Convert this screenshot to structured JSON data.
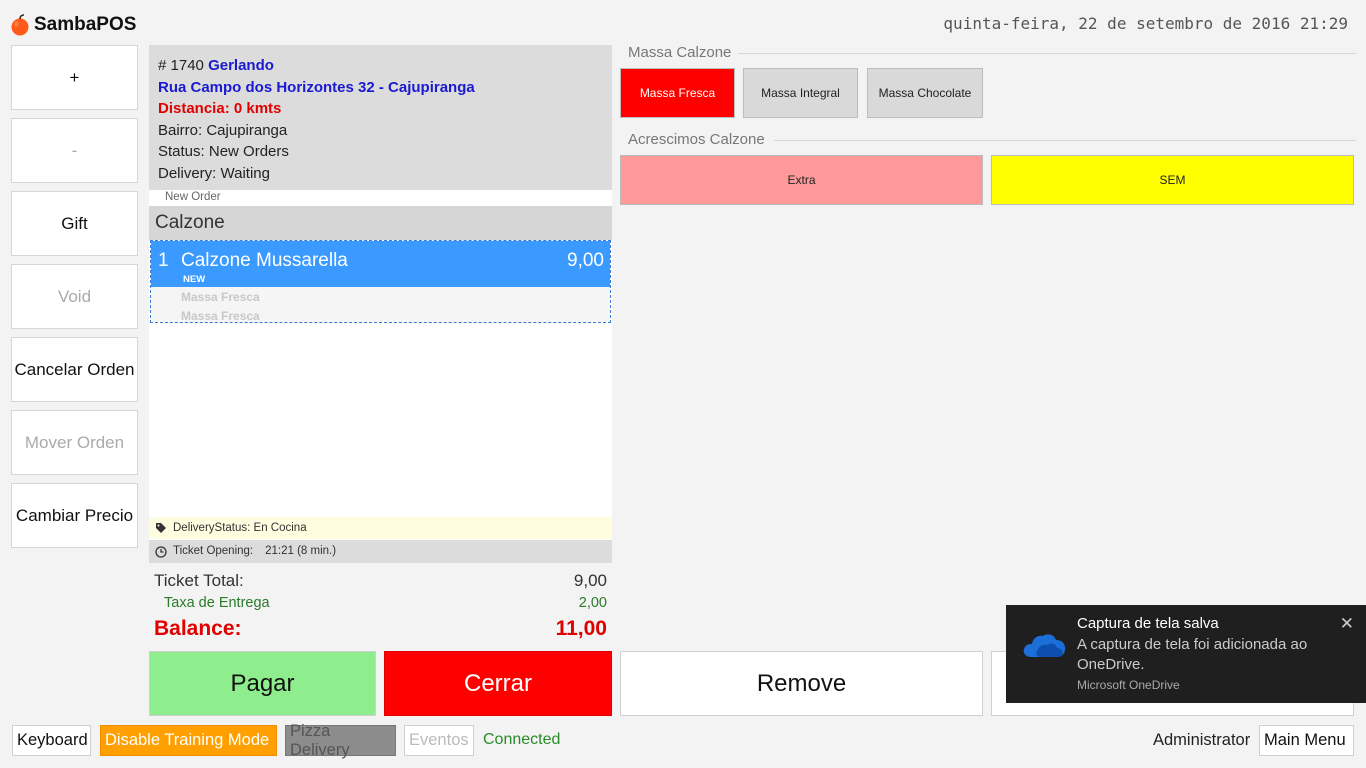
{
  "header": {
    "app_name": "SambaPOS",
    "datetime": "quinta-feira, 22 de setembro de 2016 21:29"
  },
  "commands": [
    {
      "label": "+",
      "enabled": true
    },
    {
      "label": "-",
      "enabled": false
    },
    {
      "label": "Gift",
      "enabled": true
    },
    {
      "label": "Void",
      "enabled": false
    },
    {
      "label": "Cancelar Orden",
      "enabled": true
    },
    {
      "label": "Mover Orden",
      "enabled": false
    },
    {
      "label": "Cambiar Precio",
      "enabled": true
    }
  ],
  "ticket": {
    "number": "# 1740",
    "customer": "Gerlando",
    "address": "Rua Campo dos Horizontes 32 - Cajupiranga",
    "distance": "Distancia: 0 kmts",
    "bairro": "Bairro: Cajupiranga",
    "status": "Status: New Orders",
    "delivery": "Delivery: Waiting",
    "new_order_label": "New Order",
    "group": "Calzone",
    "order": {
      "qty": "1",
      "name": "Calzone Mussarella",
      "price": "9,00",
      "badge": "NEW",
      "modifiers": [
        "Massa Fresca",
        "Massa Fresca"
      ]
    },
    "delivery_status": "DeliveryStatus: En Cocina",
    "opening_label": "Ticket Opening:",
    "opening_value": "21:21 (8 min.)"
  },
  "totals": {
    "total_label": "Ticket Total:",
    "total_value": "9,00",
    "tax_label": "Taxa de Entrega",
    "tax_value": "2,00",
    "balance_label": "Balance:",
    "balance_value": "11,00"
  },
  "actions": {
    "pagar": "Pagar",
    "cerrar": "Cerrar",
    "remove": "Remove"
  },
  "modifiers": {
    "massa_title": "Massa Calzone",
    "massa_options": [
      "Massa Fresca",
      "Massa Integral",
      "Massa Chocolate"
    ],
    "acrescimos_title": "Acrescimos Calzone",
    "acrescimos_options": [
      "Extra",
      "SEM"
    ]
  },
  "statusbar": {
    "keyboard": "Keyboard",
    "training": "Disable Training Mode",
    "pizza": "Pizza Delivery",
    "eventos": "Eventos",
    "connected": "Connected",
    "user": "Administrator",
    "main_menu": "Main Menu"
  },
  "toast": {
    "title": "Captura de tela salva",
    "body": "A captura de tela foi adicionada ao OneDrive.",
    "source": "Microsoft OneDrive"
  },
  "colors": {
    "selected_line": "#3b9aff",
    "pagar": "#8eee8e",
    "cerrar": "#ff0000",
    "training": "#ffa000",
    "extra": "#ff9999",
    "sem": "#ffff00"
  }
}
